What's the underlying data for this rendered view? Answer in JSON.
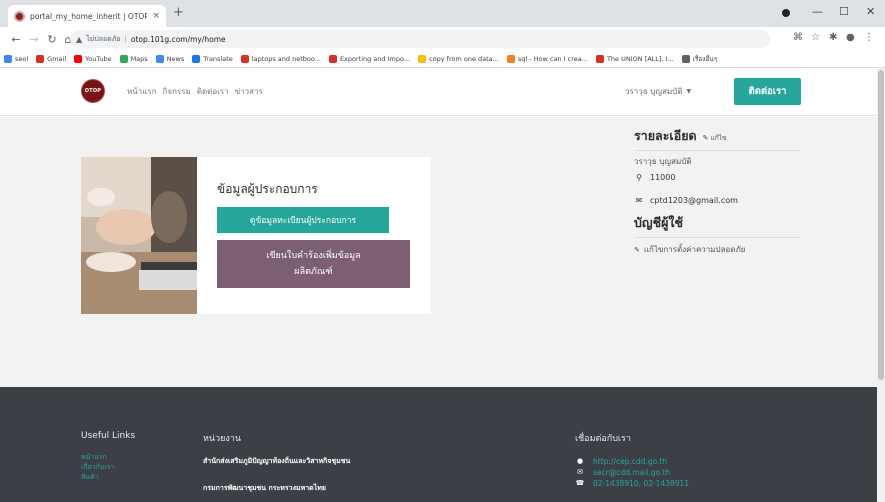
{
  "browser": {
    "tab_title": "portal_my_home_inherit | OTOP :",
    "tab_close": "×",
    "new_tab": "+",
    "win_min": "—",
    "win_max": "☐",
    "win_close": "✕",
    "insecure_label": "ไม่ปลอดภัย",
    "url": "otop.101g.com/my/home",
    "bookmarks": [
      {
        "label": "seol",
        "color": "#4285f4"
      },
      {
        "label": "Gmail",
        "color": "#d93025"
      },
      {
        "label": "YouTube",
        "color": "#ff0000"
      },
      {
        "label": "Maps",
        "color": "#34a853"
      },
      {
        "label": "News",
        "color": "#4285f4"
      },
      {
        "label": "Translate",
        "color": "#1a73e8"
      },
      {
        "label": "laptops and netboo...",
        "color": "#d93025"
      },
      {
        "label": "Exporting and Impo...",
        "color": "#d93025"
      },
      {
        "label": "copy from one data...",
        "color": "#fbbc04"
      },
      {
        "label": "sql - How can I crea...",
        "color": "#f48024"
      },
      {
        "label": "The UNION [ALL], I...",
        "color": "#d93025"
      },
      {
        "label": "เรื่องอื่นๆ",
        "color": "#5f6368"
      }
    ]
  },
  "header": {
    "logo_text": "OTOP",
    "nav": [
      "หน้าแรก",
      "กิจกรรม",
      "ติดต่อเรา",
      "ข่าวสาร"
    ],
    "user_name": "วราวุธ บุญสมบัติ",
    "contact_button": "ติดต่อเรา"
  },
  "card": {
    "title": "ข้อมูลผู้ประกอบการ",
    "register_button": "ดูข้อมูลทะเบียนผู้ประกอบการ",
    "request_line1": "เขียนใบคำร้องเพิ่มข้อมูล",
    "request_line2": "ผลิตภัณฑ์"
  },
  "details": {
    "title": "รายละเอียด",
    "edit_label": "แก้ไข",
    "name": "วราวุธ บุญสมบัติ",
    "postcode": "11000",
    "email": "cptd1203@gmail.com",
    "account_title": "บัญชีผู้ใช้",
    "security_link": "แก้ไขการตั้งค่าความปลอดภัย"
  },
  "footer": {
    "useful_links_title": "Useful Links",
    "links": [
      "หน้าแรก",
      "เกี่ยวกับเรา",
      "สินค้า"
    ],
    "agency_title": "หน่วยงาน",
    "agency_1": "สำนักส่งเสริมภูมิปัญญาท้องถิ่นและวิสาหกิจชุมชน",
    "agency_2": "กรมการพัฒนาชุมชน กระทรวงมหาดไทย",
    "contact_title": "เชื่อมต่อกับเรา",
    "website": "http://cep.cdd.go.th",
    "mail": "secr@cdd.mail.go.th",
    "phone": "02-1438910, 02-1438911"
  },
  "colors": {
    "accent": "#26a69a",
    "request_button": "#7d5f74",
    "footer_bg": "#3c4046",
    "logo": "#7a1414"
  }
}
